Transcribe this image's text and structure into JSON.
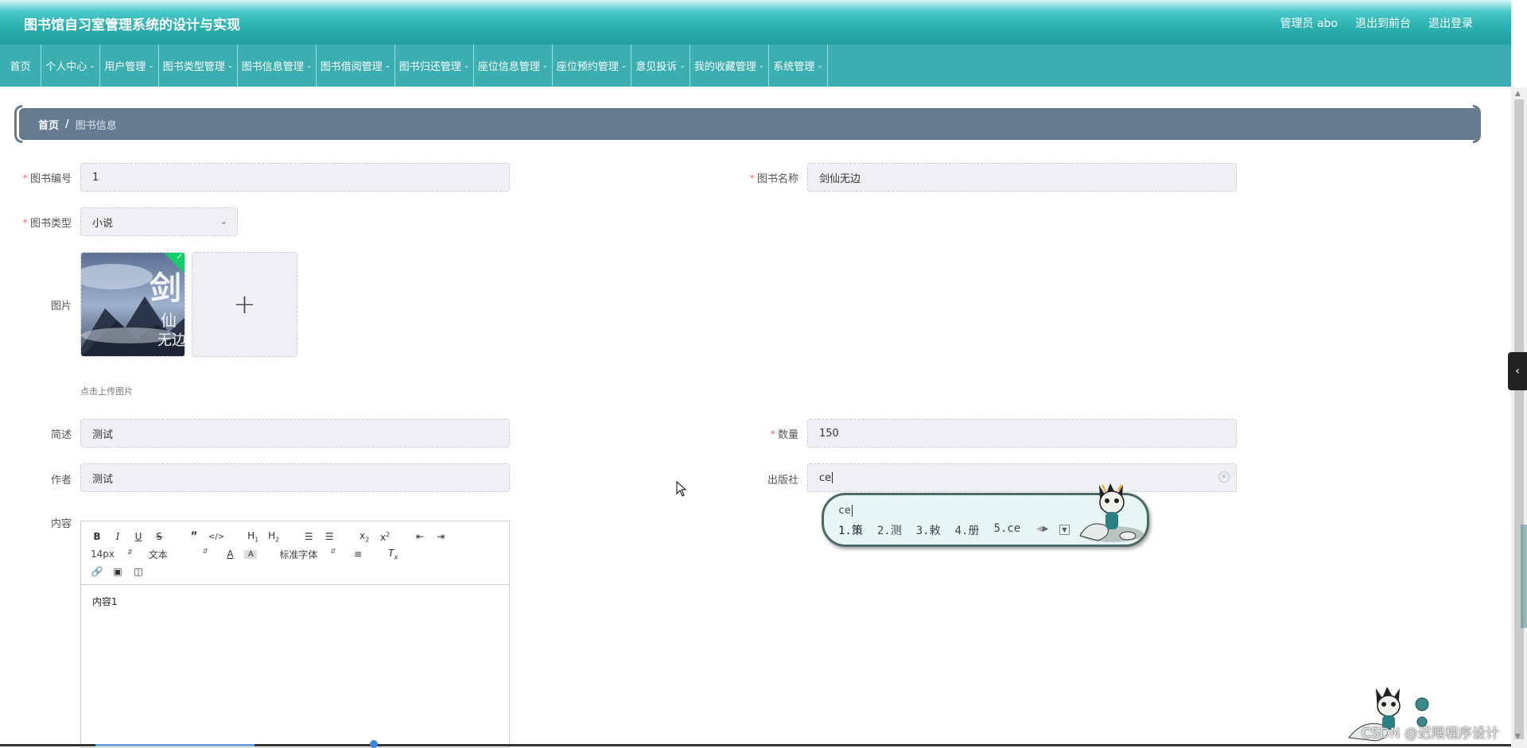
{
  "header": {
    "title": "图书馆自习室管理系统的设计与实现",
    "user": "管理员 abo",
    "to_frontend": "退出到前台",
    "logout": "退出登录"
  },
  "nav": [
    {
      "label": "首页",
      "dropdown": false
    },
    {
      "label": "个人中心",
      "dropdown": true
    },
    {
      "label": "用户管理",
      "dropdown": true
    },
    {
      "label": "图书类型管理",
      "dropdown": true
    },
    {
      "label": "图书信息管理",
      "dropdown": true
    },
    {
      "label": "图书借阅管理",
      "dropdown": true
    },
    {
      "label": "图书归还管理",
      "dropdown": true
    },
    {
      "label": "座位信息管理",
      "dropdown": true
    },
    {
      "label": "座位预约管理",
      "dropdown": true
    },
    {
      "label": "意见投诉",
      "dropdown": true
    },
    {
      "label": "我的收藏管理",
      "dropdown": true
    },
    {
      "label": "系统管理",
      "dropdown": true
    }
  ],
  "breadcrumb": {
    "home": "首页",
    "sep": "/",
    "current": "图书信息"
  },
  "form": {
    "book_no": {
      "label": "图书编号",
      "value": "1",
      "required": true
    },
    "book_name": {
      "label": "图书名称",
      "value": "剑仙无边",
      "required": true
    },
    "book_type": {
      "label": "图书类型",
      "value": "小说",
      "required": true
    },
    "image": {
      "label": "图片",
      "hint": "点击上传图片",
      "cover_text": "剑仙无边"
    },
    "summary": {
      "label": "简述",
      "value": "测试"
    },
    "quantity": {
      "label": "数量",
      "value": "150",
      "required": true
    },
    "author": {
      "label": "作者",
      "value": "测试"
    },
    "publisher": {
      "label": "出版社",
      "value": "ce"
    },
    "content": {
      "label": "内容",
      "value": "内容1"
    }
  },
  "editor": {
    "font_size": "14px",
    "block_type": "文本",
    "font_family": "标准字体"
  },
  "ime": {
    "input": "ce",
    "candidates": [
      "1.策",
      "2.测",
      "3.敕",
      "4.册",
      "5.ce"
    ]
  },
  "watermark": "CSDN @迟限程序设计",
  "colors": {
    "header": "#2ab0b0",
    "nav": "#3aaeb1",
    "breadcrumb": "#667a92",
    "required": "#f56c6c",
    "input_bg": "#eef0f5"
  }
}
